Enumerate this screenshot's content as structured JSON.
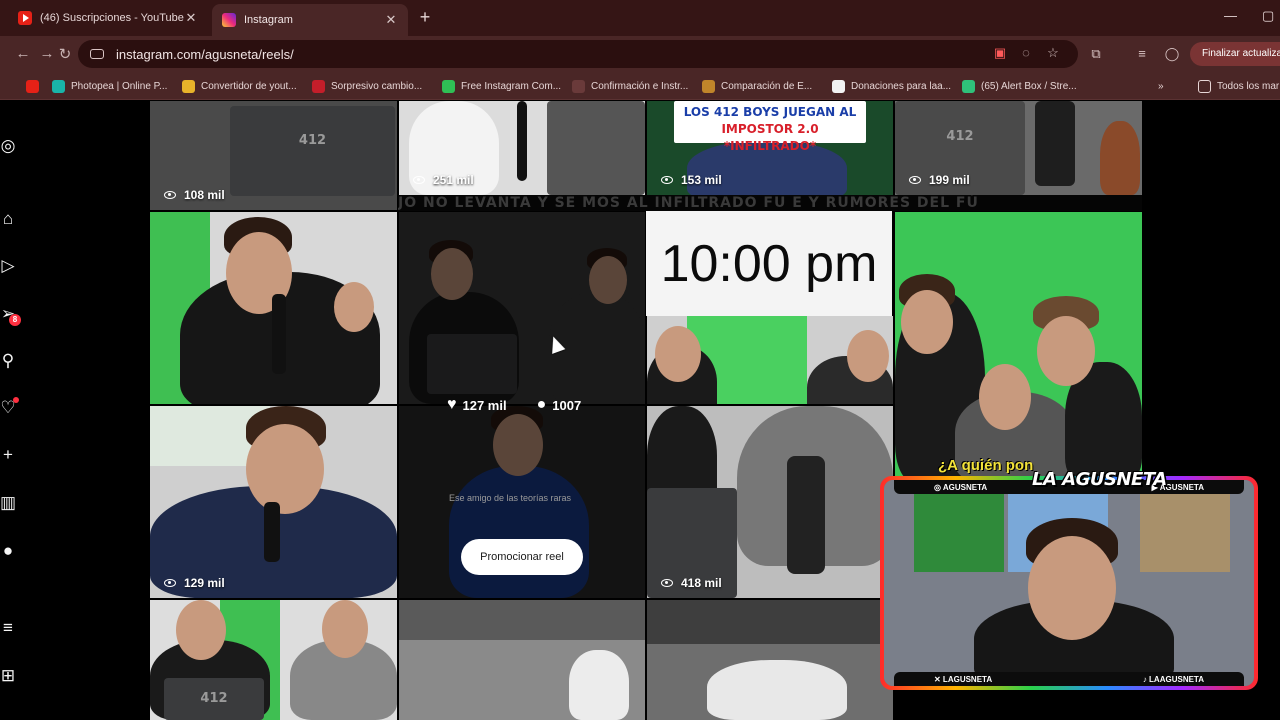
{
  "browser": {
    "tabs": [
      {
        "title": "(46) Suscripciones - YouTube",
        "close": "✕"
      },
      {
        "title": "Instagram",
        "close": "✕"
      }
    ],
    "new_tab": "+",
    "url": "instagram.com/agusneta/reels/",
    "update_button": "Finalizar actualiza",
    "bookmarks": [
      {
        "label": "Photopea | Online P...",
        "color": "#19b4a8"
      },
      {
        "label": "Convertidor de yout...",
        "color": "#e8b32a"
      },
      {
        "label": "Sorpresivo cambio...",
        "color": "#c41e2a"
      },
      {
        "label": "Free Instagram Com...",
        "color": "#2fbf55"
      },
      {
        "label": "Confirmación e Instr...",
        "color": "#4a2626"
      },
      {
        "label": "Comparación de E...",
        "color": "#c0852a"
      },
      {
        "label": "Donaciones para laa...",
        "color": "#f2f2f2"
      },
      {
        "label": "(65) Alert Box / Stre...",
        "color": "#2fc07a"
      },
      {
        "label": "Todos los mar",
        "color": "#4a2626"
      }
    ],
    "bookmarks_overflow": "»"
  },
  "sidebar": {
    "icons": [
      "instagram-icon",
      "home-icon",
      "reels-icon",
      "messages-icon",
      "search-icon",
      "notifications-icon",
      "create-icon",
      "dashboard-icon",
      "profile-icon",
      "menu-icon",
      "more-icon"
    ],
    "messages_badge": "8"
  },
  "reels": {
    "row1": [
      {
        "views": "108 mil"
      },
      {
        "views": "251 mil"
      },
      {
        "views": "153 mil",
        "banner_line1": "LOS 412 BOYS JUEGAN AL",
        "banner_line2": "IMPOSTOR 2.0 *INFILTRADO*"
      },
      {
        "views": "199 mil"
      }
    ],
    "ticker": "JO NO LEVANTA Y SE  MOS AL INFILTRADO FU  E Y RUMORES DEL FÚ",
    "clock": "10:00 pm",
    "row2": [
      {
        "views": "129 mil"
      },
      {
        "likes": "127 mil",
        "comments": "1007",
        "caption": "Ese amigo de las teorías raras",
        "promote": "Promocionar reel"
      },
      {
        "views": "418 mil"
      }
    ],
    "laptop_brand": "412"
  },
  "webcam": {
    "question": "¿A quién pon",
    "brand": "LA AGUSNETA",
    "top_left": "◎ AGUSNETA",
    "top_right": "▶ AGUSNETA",
    "bottom_left": "✕ LAGUSNETA",
    "bottom_right": "♪ LAAGUSNETA"
  }
}
